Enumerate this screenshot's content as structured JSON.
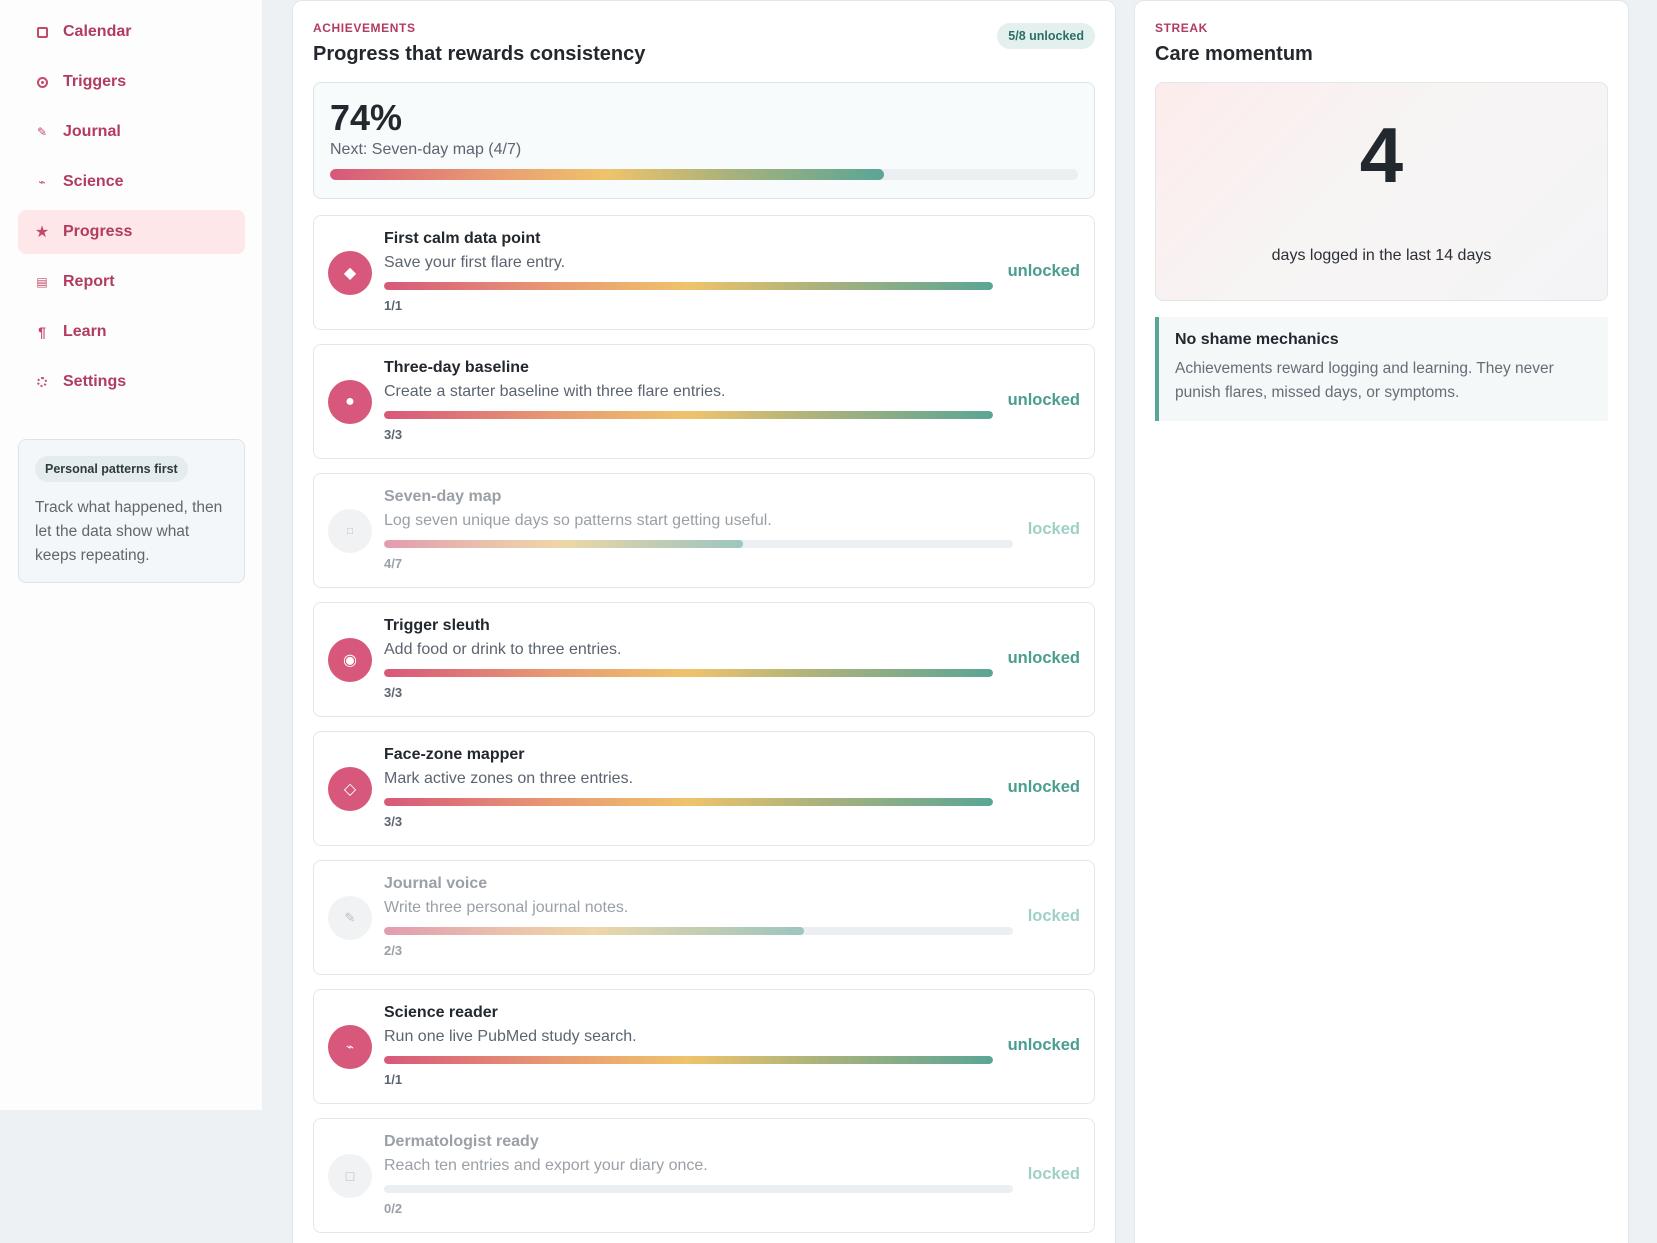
{
  "sidebar": {
    "items": [
      {
        "label": "Calendar",
        "icon": "calendar-icon"
      },
      {
        "label": "Triggers",
        "icon": "target-icon"
      },
      {
        "label": "Journal",
        "icon": "pencil-icon"
      },
      {
        "label": "Science",
        "icon": "pulse-icon"
      },
      {
        "label": "Progress",
        "icon": "star-icon",
        "active": true
      },
      {
        "label": "Report",
        "icon": "report-icon"
      },
      {
        "label": "Learn",
        "icon": "paragraph-icon"
      },
      {
        "label": "Settings",
        "icon": "gear-icon"
      }
    ],
    "card": {
      "badge": "Personal patterns first",
      "text": "Track what happened, then let the data show what keeps repeating."
    }
  },
  "achievements": {
    "eyebrow": "ACHIEVEMENTS",
    "title": "Progress that rewards consistency",
    "count_badge": "5/8 unlocked",
    "summary": {
      "percent": "74%",
      "percent_value": 0.74,
      "next": "Next: Seven-day map (4/7)"
    },
    "items": [
      {
        "title": "First calm data point",
        "desc": "Save your first flare entry.",
        "progress": "1/1",
        "fraction": 1.0,
        "status": "unlocked",
        "icon": "diamond-icon"
      },
      {
        "title": "Three-day baseline",
        "desc": "Create a starter baseline with three flare entries.",
        "progress": "3/3",
        "fraction": 1.0,
        "status": "unlocked",
        "icon": "circle-icon"
      },
      {
        "title": "Seven-day map",
        "desc": "Log seven unique days so patterns start getting useful.",
        "progress": "4/7",
        "fraction": 0.571,
        "status": "locked",
        "icon": "square-icon"
      },
      {
        "title": "Trigger sleuth",
        "desc": "Add food or drink to three entries.",
        "progress": "3/3",
        "fraction": 1.0,
        "status": "unlocked",
        "icon": "target-icon"
      },
      {
        "title": "Face-zone mapper",
        "desc": "Mark active zones on three entries.",
        "progress": "3/3",
        "fraction": 1.0,
        "status": "unlocked",
        "icon": "diamond-outline-icon"
      },
      {
        "title": "Journal voice",
        "desc": "Write three personal journal notes.",
        "progress": "2/3",
        "fraction": 0.667,
        "status": "locked",
        "icon": "pencil-icon"
      },
      {
        "title": "Science reader",
        "desc": "Run one live PubMed study search.",
        "progress": "1/1",
        "fraction": 1.0,
        "status": "unlocked",
        "icon": "pulse-icon"
      },
      {
        "title": "Dermatologist ready",
        "desc": "Reach ten entries and export your diary once.",
        "progress": "0/2",
        "fraction": 0.0,
        "status": "locked",
        "icon": "square-icon"
      }
    ]
  },
  "streak": {
    "eyebrow": "STREAK",
    "title": "Care momentum",
    "number": "4",
    "label": "days logged in the last 14 days",
    "note_title": "No shame mechanics",
    "note_text": "Achievements reward logging and learning. They never punish flares, missed days, or symptoms."
  },
  "colors": {
    "accent": "#b23c5f",
    "unlocked": "#4a9e8f",
    "icon_active": "#d7587a"
  }
}
